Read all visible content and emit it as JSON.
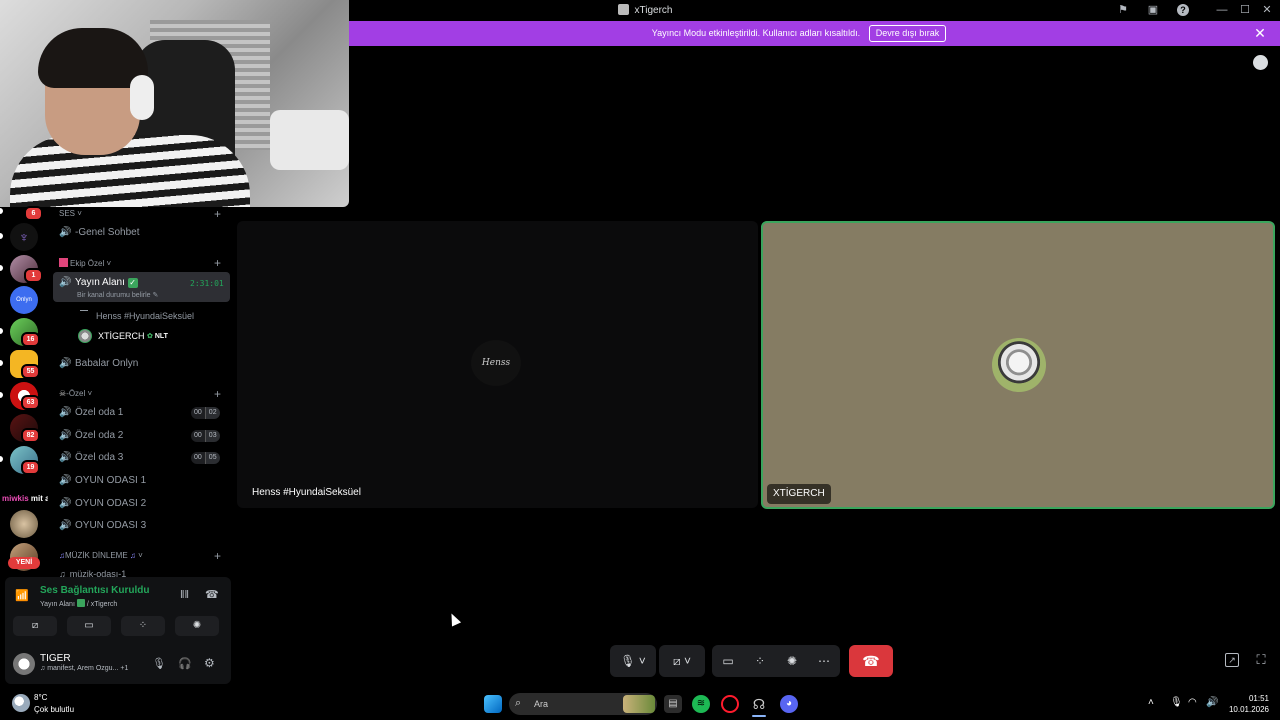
{
  "window": {
    "title": "xTigerch"
  },
  "banner": {
    "text": "Yayıncı Modu etkinleştirildi. Kullanıcı adları kısaltıldı.",
    "button": "Devre dışı bırak",
    "color": "#a23ee4"
  },
  "rail": {
    "badges": [
      "6",
      "1",
      "16",
      "55",
      "63",
      "82",
      "19"
    ],
    "new_label": "YENİ",
    "overlay_text": "miwkis",
    "overlay_text2": "mit ajan"
  },
  "channels": {
    "categories": {
      "ses": "SES",
      "ekip": "Ekip Özel",
      "ozel": "-Özel",
      "muzik": "MÜZİK DİNLEME"
    },
    "genel": "-Genel Sohbet",
    "active": {
      "name": "Yayın Alanı",
      "timer": "2:31:01",
      "status": "Bir kanal durumu belirle",
      "members": [
        {
          "name": "Henss #HyundaiSeksüel"
        },
        {
          "name": "XTİGERCH",
          "tag": "NLT"
        }
      ]
    },
    "babalar": "Babalar Onlyn",
    "rooms": [
      {
        "name": "Özel oda 1",
        "count": "00",
        "limit": "02"
      },
      {
        "name": "Özel oda 2",
        "count": "00",
        "limit": "03"
      },
      {
        "name": "Özel oda 3",
        "count": "00",
        "limit": "05"
      }
    ],
    "games": [
      "OYUN ODASI 1",
      "OYUN ODASI 2",
      "OYUN ODASI 3"
    ],
    "music_partial": "müzik-odası-1"
  },
  "voice": {
    "status": "Ses Bağlantısı Kuruldu",
    "location": "Yayın Alanı",
    "server": "/ xTigerch",
    "status_color": "#23a55a"
  },
  "user": {
    "name": "TIGER",
    "activity": "manifest, Arem Ozgu...",
    "extra": "+1"
  },
  "call": {
    "left_label": "Henss #HyundaiSeksüel",
    "right_label": "XTİGERCH",
    "left_avatar_text": "Henss"
  },
  "taskbar": {
    "weather_temp": "8°C",
    "weather_desc": "Çok bulutlu",
    "search_placeholder": "Ara",
    "time": "01:51",
    "date": "10.01.2026"
  }
}
